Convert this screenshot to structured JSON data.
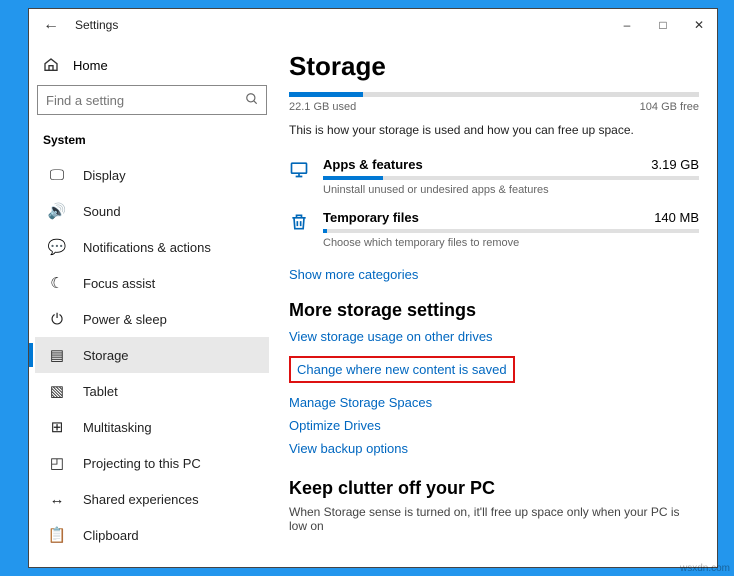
{
  "titlebar": {
    "title": "Settings"
  },
  "sidebar": {
    "home": "Home",
    "searchPlaceholder": "Find a setting",
    "section": "System",
    "items": [
      {
        "label": "Display"
      },
      {
        "label": "Sound"
      },
      {
        "label": "Notifications & actions"
      },
      {
        "label": "Focus assist"
      },
      {
        "label": "Power & sleep"
      },
      {
        "label": "Storage"
      },
      {
        "label": "Tablet"
      },
      {
        "label": "Multitasking"
      },
      {
        "label": "Projecting to this PC"
      },
      {
        "label": "Shared experiences"
      },
      {
        "label": "Clipboard"
      }
    ]
  },
  "main": {
    "title": "Storage",
    "used": "22.1 GB used",
    "free": "104 GB free",
    "usedPct": 18,
    "description": "This is how your storage is used and how you can free up space.",
    "categories": [
      {
        "name": "Apps & features",
        "size": "3.19 GB",
        "pct": 16,
        "sub": "Uninstall unused or undesired apps & features"
      },
      {
        "name": "Temporary files",
        "size": "140 MB",
        "pct": 1,
        "sub": "Choose which temporary files to remove"
      }
    ],
    "showMore": "Show more categories",
    "more": {
      "heading": "More storage settings",
      "links": [
        "View storage usage on other drives",
        "Change where new content is saved",
        "Manage Storage Spaces",
        "Optimize Drives",
        "View backup options"
      ]
    },
    "keep": {
      "heading": "Keep clutter off your PC",
      "body": "When Storage sense is turned on, it'll free up space only when your PC is low on"
    }
  },
  "watermark": "wsxdn.com"
}
